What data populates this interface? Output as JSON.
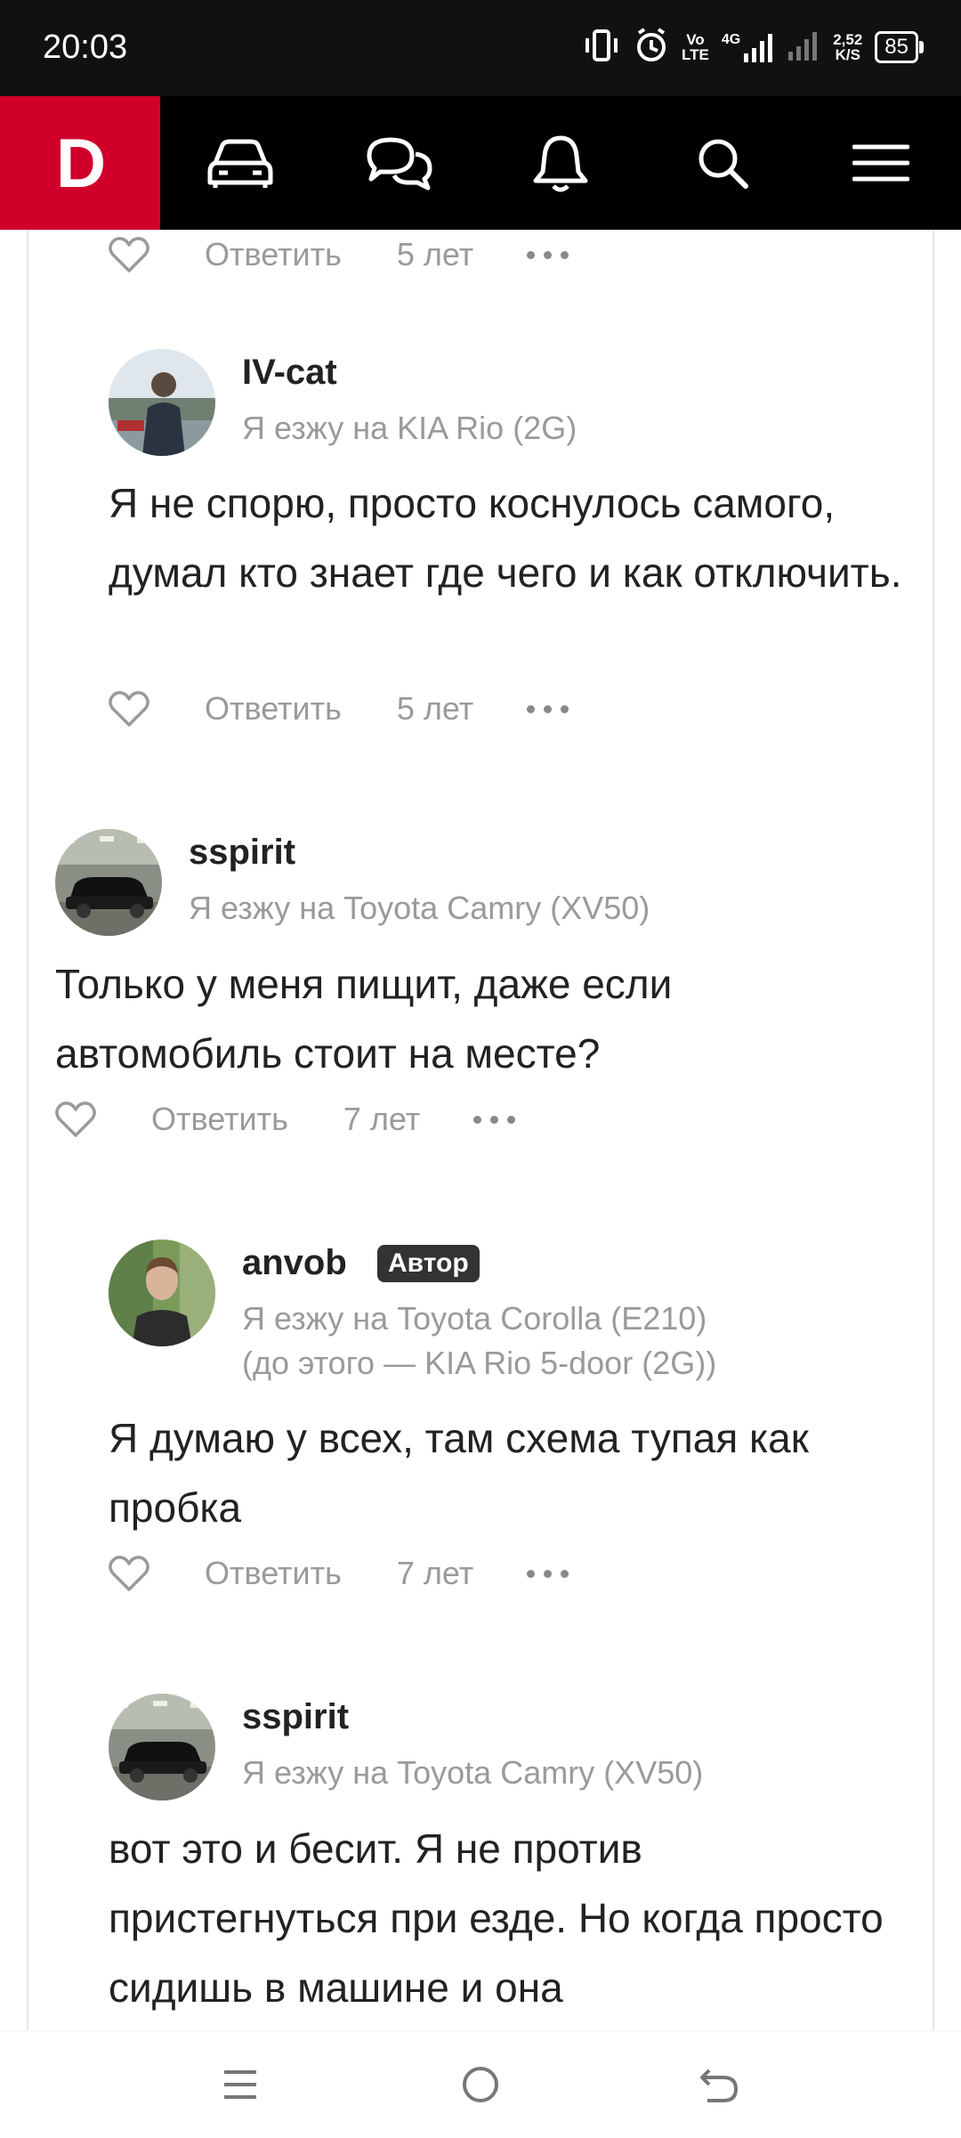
{
  "status_bar": {
    "time": "20:03",
    "net_top": "Vo",
    "net_bottom": "LTE",
    "net_type": "4G",
    "speed_value": "2,52",
    "speed_unit": "K/S",
    "battery": "85",
    "icons": [
      "vibrate-icon",
      "alarm-icon",
      "signal-icon",
      "signal-weak-icon",
      "battery-icon"
    ]
  },
  "app_bar": {
    "logo": "D",
    "nav": [
      "car-icon",
      "messages-icon",
      "bell-icon",
      "search-icon",
      "menu-icon"
    ],
    "brand_color": "#d0002b"
  },
  "top_actions": {
    "reply": "Ответить",
    "age": "5 лет"
  },
  "comments": [
    {
      "user": "IV-cat",
      "car": "Я езжу на KIA Rio (2G)",
      "text": "Я не спорю, просто коснулось самого, думал кто знает где чего и как отключить.",
      "reply": "Ответить",
      "age": "5 лет"
    },
    {
      "user": "sspirit",
      "car": "Я езжу на Toyota Camry (XV50)",
      "text": "Только у меня пищит, даже если автомобиль стоит на месте?",
      "reply": "Ответить",
      "age": "7 лет"
    },
    {
      "user": "anvob",
      "badge": "Автор",
      "car": "Я езжу на Toyota Corolla (E210)",
      "car_prev": "(до этого — KIA Rio 5-door (2G))",
      "text": "Я думаю у всех, там схема тупая как пробка",
      "reply": "Ответить",
      "age": "7 лет"
    },
    {
      "user": "sspirit",
      "car": "Я езжу на Toyota Camry (XV50)",
      "text": "вот это и бесит. Я не против пристегнуться при езде. Но когда просто сидишь в машине и она"
    }
  ],
  "system_nav": [
    "recents-icon",
    "home-icon",
    "back-icon"
  ]
}
